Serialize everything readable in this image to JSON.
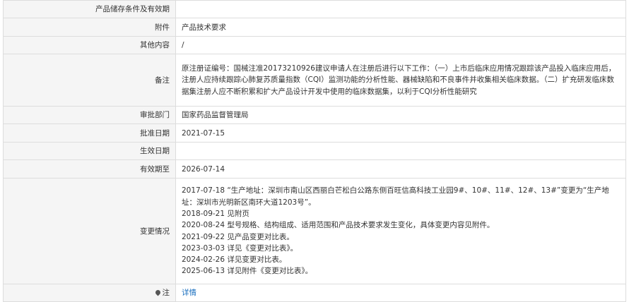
{
  "rows": {
    "storage": {
      "label": "产品储存条件及有效期",
      "value": ""
    },
    "attachment": {
      "label": "附件",
      "value": "产品技术要求"
    },
    "other": {
      "label": "其他内容",
      "value": "/"
    },
    "remark": {
      "label": "备注",
      "value": "原注册证编号：国械注准20173210926建议申请人在注册后进行以下工作：（一）上市后临床应用情况跟踪该产品投入临床应用后，注册人应持续跟踪心肺复苏质量指数（CQI）监测功能的分析性能、器械缺陷和不良事件并收集相关临床数据。（二）扩充研发临床数据集注册人应不断积累和扩大产品设计开发中使用的临床数据集，以利于CQI分析性能研究"
    },
    "authority": {
      "label": "审批部门",
      "value": "国家药品监督管理局"
    },
    "approval_date": {
      "label": "批准日期",
      "value": "2021-07-15"
    },
    "effective_date": {
      "label": "生效日期",
      "value": ""
    },
    "valid_until": {
      "label": "有效期至",
      "value": "2026-07-14"
    },
    "changes": {
      "label": "变更情况",
      "items": [
        "2017-07-18 “生产地址：深圳市南山区西丽白芒松白公路东侧百旺信高科技工业园9#、10#、11#、12#、13#”变更为“生产地址：深圳市光明新区南环大道1203号”。",
        "2018-09-21 见附页",
        "2020-08-24 型号规格、结构组成、适用范围和产品技术要求发生变化，具体变更内容见附件。",
        "2021-09-22 见产品变更对比表。",
        "2023-03-03 详见《变更对比表》。",
        "2024-02-26 详见变更对比表。",
        "2025-06-13 详见附件《变更对比表》。"
      ]
    },
    "note": {
      "label": "注",
      "icon": "location-pin-icon",
      "link": "详情"
    }
  }
}
